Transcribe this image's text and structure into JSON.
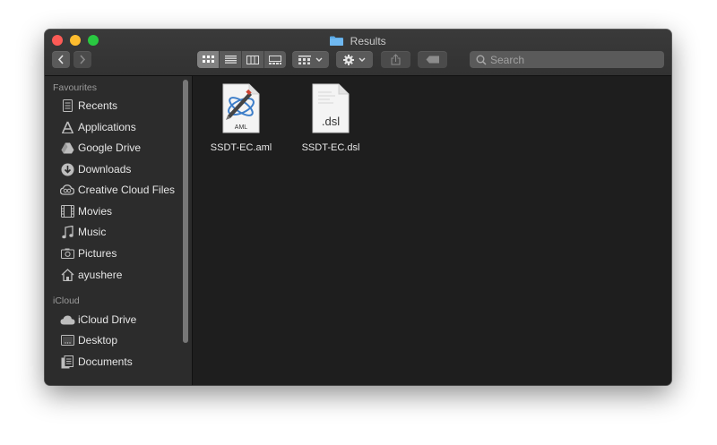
{
  "window": {
    "title": "Results"
  },
  "toolbar": {
    "back": "back-icon",
    "forward": "forward-icon",
    "view_modes": [
      "icon-view",
      "list-view",
      "column-view",
      "gallery-view"
    ],
    "search_placeholder": "Search"
  },
  "sidebar": {
    "favourites_heading": "Favourites",
    "favourites": [
      {
        "label": "Recents",
        "icon": "recents-icon"
      },
      {
        "label": "Applications",
        "icon": "applications-icon"
      },
      {
        "label": "Google Drive",
        "icon": "google-drive-icon"
      },
      {
        "label": "Downloads",
        "icon": "downloads-icon"
      },
      {
        "label": "Creative Cloud Files",
        "icon": "creative-cloud-icon"
      },
      {
        "label": "Movies",
        "icon": "movies-icon"
      },
      {
        "label": "Music",
        "icon": "music-icon"
      },
      {
        "label": "Pictures",
        "icon": "pictures-icon"
      },
      {
        "label": "ayushere",
        "icon": "home-icon"
      }
    ],
    "icloud_heading": "iCloud",
    "icloud": [
      {
        "label": "iCloud Drive",
        "icon": "icloud-icon"
      },
      {
        "label": "Desktop",
        "icon": "desktop-icon"
      },
      {
        "label": "Documents",
        "icon": "documents-icon"
      }
    ]
  },
  "files": [
    {
      "name": "SSDT-EC.aml",
      "badge": "AML"
    },
    {
      "name": "SSDT-EC.dsl",
      "badge": ".dsl"
    }
  ]
}
